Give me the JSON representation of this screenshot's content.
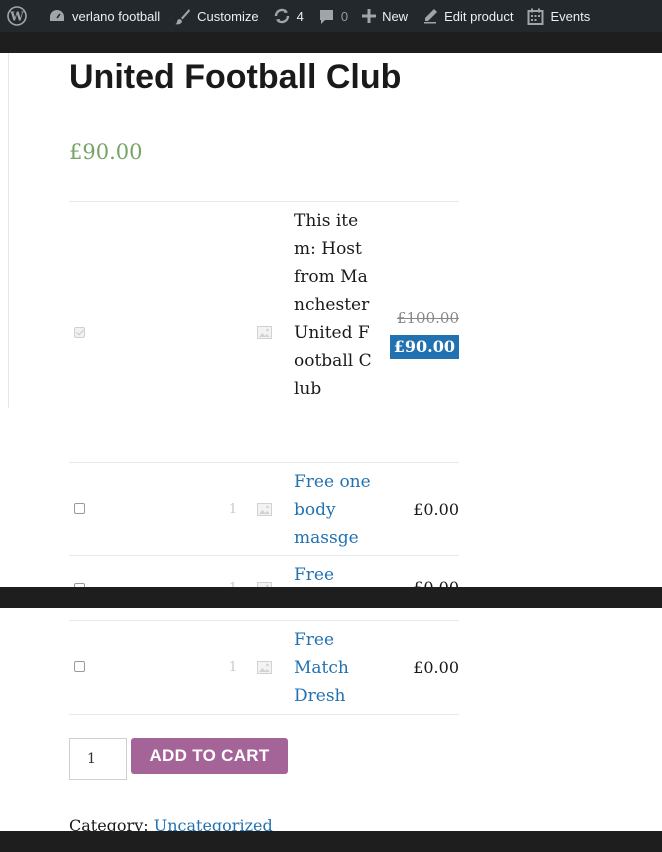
{
  "admin_bar": {
    "site_name": "verlano football",
    "customize": "Customize",
    "updates_count": "4",
    "comments_count": "0",
    "new_label": "New",
    "edit_product": "Edit product",
    "events": "Events"
  },
  "product": {
    "title": "United Football Club",
    "price": "£90.00"
  },
  "bundle": {
    "rows": [
      {
        "name": "This item: Host from Manchester United Football Club",
        "old_price": "£100.00",
        "price": "£90.00",
        "checked": true
      },
      {
        "qty": "1",
        "name": "Free one body massge",
        "price": "£0.00"
      },
      {
        "qty": "1",
        "name": "Free",
        "price": "£0.00"
      },
      {
        "qty": "1",
        "name": "Free Match Dresh",
        "price": "£0.00"
      }
    ]
  },
  "cart": {
    "quantity": "1",
    "button_label": "ADD TO CART"
  },
  "meta": {
    "category_label": "Category:",
    "category_value": "Uncategorized"
  },
  "colors": {
    "price_green": "#77a464",
    "link_blue": "#2271b1",
    "button_purple": "#a46497",
    "admin_bar": "#23282d"
  }
}
